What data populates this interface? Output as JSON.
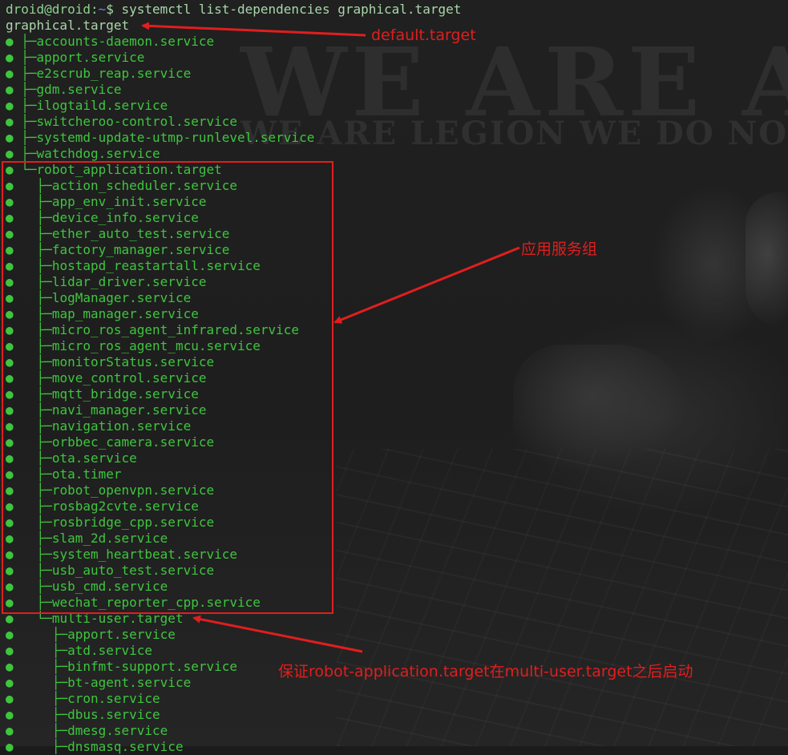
{
  "terminal": {
    "prompt": {
      "user_host": "droid@droid:",
      "path": "~",
      "symbol": "$",
      "command": " systemctl list-dependencies graphical.target"
    },
    "root_unit": "graphical.target",
    "bullet_glyph": "●",
    "top_level_units": [
      {
        "branch": "├─",
        "name": "accounts-daemon.service"
      },
      {
        "branch": "├─",
        "name": "apport.service"
      },
      {
        "branch": "├─",
        "name": "e2scrub_reap.service"
      },
      {
        "branch": "├─",
        "name": "gdm.service"
      },
      {
        "branch": "├─",
        "name": "ilogtaild.service"
      },
      {
        "branch": "├─",
        "name": "switcheroo-control.service"
      },
      {
        "branch": "├─",
        "name": "systemd-update-utmp-runlevel.service"
      },
      {
        "branch": "├─",
        "name": "watchdog.service"
      },
      {
        "branch": "└─",
        "name": "robot_application.target"
      }
    ],
    "robot_application_units": [
      {
        "branch": "├─",
        "name": "action_scheduler.service"
      },
      {
        "branch": "├─",
        "name": "app_env_init.service"
      },
      {
        "branch": "├─",
        "name": "device_info.service"
      },
      {
        "branch": "├─",
        "name": "ether_auto_test.service"
      },
      {
        "branch": "├─",
        "name": "factory_manager.service"
      },
      {
        "branch": "├─",
        "name": "hostapd_reastartall.service"
      },
      {
        "branch": "├─",
        "name": "lidar_driver.service"
      },
      {
        "branch": "├─",
        "name": "logManager.service"
      },
      {
        "branch": "├─",
        "name": "map_manager.service"
      },
      {
        "branch": "├─",
        "name": "micro_ros_agent_infrared.service"
      },
      {
        "branch": "├─",
        "name": "micro_ros_agent_mcu.service"
      },
      {
        "branch": "├─",
        "name": "monitorStatus.service"
      },
      {
        "branch": "├─",
        "name": "move_control.service"
      },
      {
        "branch": "├─",
        "name": "mqtt_bridge.service"
      },
      {
        "branch": "├─",
        "name": "navi_manager.service"
      },
      {
        "branch": "├─",
        "name": "navigation.service"
      },
      {
        "branch": "├─",
        "name": "orbbec_camera.service"
      },
      {
        "branch": "├─",
        "name": "ota.service"
      },
      {
        "branch": "├─",
        "name": "ota.timer"
      },
      {
        "branch": "├─",
        "name": "robot_openvpn.service"
      },
      {
        "branch": "├─",
        "name": "rosbag2cvte.service"
      },
      {
        "branch": "├─",
        "name": "rosbridge_cpp.service"
      },
      {
        "branch": "├─",
        "name": "slam_2d.service"
      },
      {
        "branch": "├─",
        "name": "system_heartbeat.service"
      },
      {
        "branch": "├─",
        "name": "usb_auto_test.service"
      },
      {
        "branch": "├─",
        "name": "usb_cmd.service"
      },
      {
        "branch": "├─",
        "name": "wechat_reporter_cpp.service"
      },
      {
        "branch": "└─",
        "name": "multi-user.target"
      }
    ],
    "multi_user_units": [
      {
        "branch": "├─",
        "name": "apport.service"
      },
      {
        "branch": "├─",
        "name": "atd.service"
      },
      {
        "branch": "├─",
        "name": "binfmt-support.service"
      },
      {
        "branch": "├─",
        "name": "bt-agent.service"
      },
      {
        "branch": "├─",
        "name": "cron.service"
      },
      {
        "branch": "├─",
        "name": "dbus.service"
      },
      {
        "branch": "├─",
        "name": "dmesg.service"
      },
      {
        "branch": "├─",
        "name": "dnsmasq.service"
      }
    ]
  },
  "wallpaper": {
    "headline": "WE ARE AN",
    "subline": "WE ARE LEGION WE DO NOT FORGIV"
  },
  "annotations": {
    "default_target": "default.target",
    "app_group": "应用服务组",
    "order_note": "保证robot-application.target在multi-user.target之后启动"
  },
  "colors": {
    "terminal_green": "#3ec53e",
    "annotation_red": "#e11e1e",
    "prompt_path_blue": "#5b8fd6"
  }
}
